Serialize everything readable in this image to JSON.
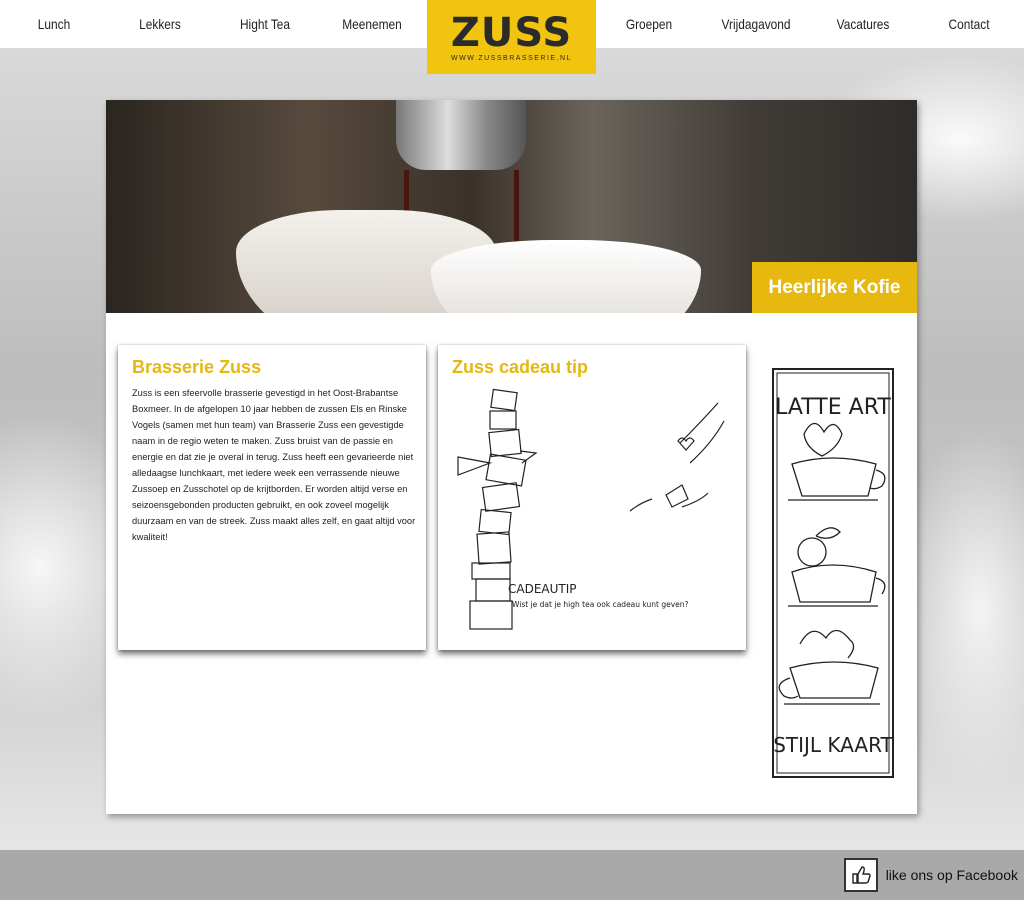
{
  "nav": {
    "items_left": [
      "Lunch",
      "Lekkers",
      "Hight Tea",
      "Meenemen"
    ],
    "items_right": [
      "Groepen",
      "Vrijdagavond",
      "Vacatures",
      "Contact"
    ],
    "logo": "ZUSS",
    "logo_url": "WWW.ZUSSBRASSERIE.NL"
  },
  "hero": {
    "caption": "Heerlijke Kofie"
  },
  "about": {
    "title": "Brasserie Zuss",
    "body": "Zuss is een sfeervolle brasserie gevestigd in het Oost-Brabantse Boxmeer. In de afgelopen 10 jaar hebben de zussen Els en Rinske Vogels (samen met hun team) van Brasserie Zuss een gevestigde naam in de regio weten te maken. Zuss bruist van de passie en energie en dat zie je overal in terug. Zuss heeft een gevarieerde niet alledaagse lunchkaart, met iedere week een verrassende nieuwe Zussoep en Zusschotel op de krijtborden. Er worden altijd verse en seizoensgebonden producten gebruikt, en ook zoveel mogelijk duurzaam en van de streek. Zuss maakt alles zelf, en gaat altijd voor kwaliteit!"
  },
  "gift": {
    "title": "Zuss cadeau tip",
    "sketch_title": "CADEAUTIP",
    "sketch_text": "Wist je dat je high tea ook cadeau kunt geven?"
  },
  "menu_card": {
    "top": "LATTE ART",
    "bottom": "STIJL KAART"
  },
  "footer": {
    "facebook": "like ons op Facebook"
  },
  "colors": {
    "accent": "#f1c40f",
    "title_yellow": "#e6b80f",
    "footer": "#a9a9a9"
  }
}
